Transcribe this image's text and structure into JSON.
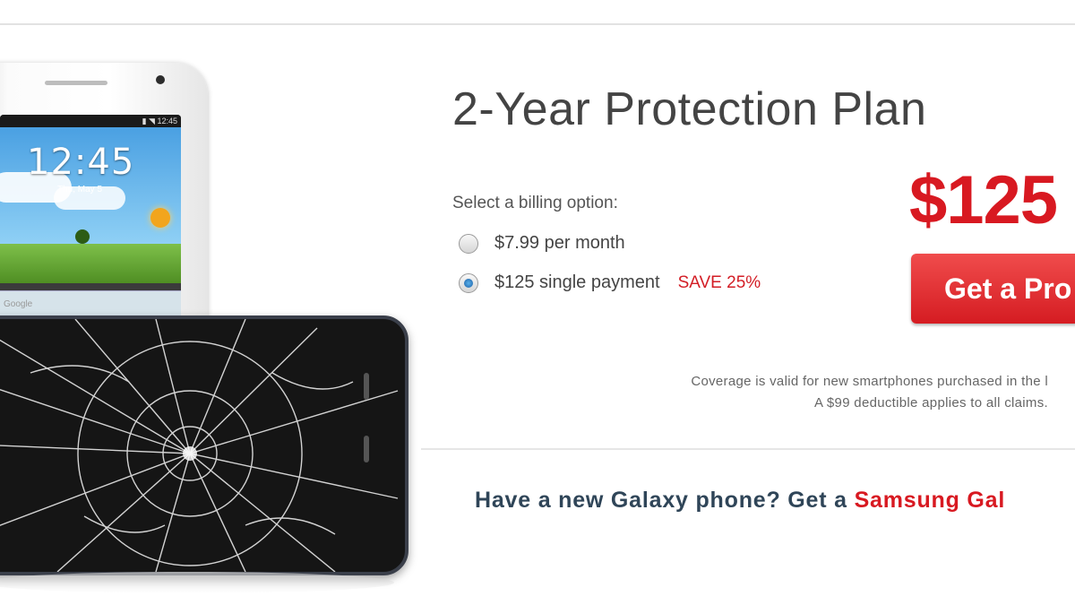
{
  "plan": {
    "title": "2-Year Protection Plan",
    "price": "$125",
    "cta_label": "Get a Pro"
  },
  "billing": {
    "label": "Select a billing option:",
    "options": [
      {
        "label": "$7.99 per month",
        "selected": false
      },
      {
        "label": "$125 single payment",
        "selected": true,
        "badge": "SAVE 25%"
      }
    ]
  },
  "coverage": {
    "line1": "Coverage is valid for new smartphones purchased in the l",
    "line2": "A $99 deductible applies to all claims."
  },
  "promo": {
    "prefix": "Have a new Galaxy phone? Get a ",
    "link": "Samsung Gal"
  },
  "phone_screen": {
    "time": "12:45",
    "date": "Thu, May 5",
    "search_hint": "Google"
  },
  "colors": {
    "accent_red": "#d81921",
    "button_red": "#e0343a",
    "title_gray": "#444444",
    "promo_navy": "#2f4558"
  },
  "icons": {
    "radio_unchecked": "radio-unchecked",
    "radio_checked": "radio-checked"
  }
}
